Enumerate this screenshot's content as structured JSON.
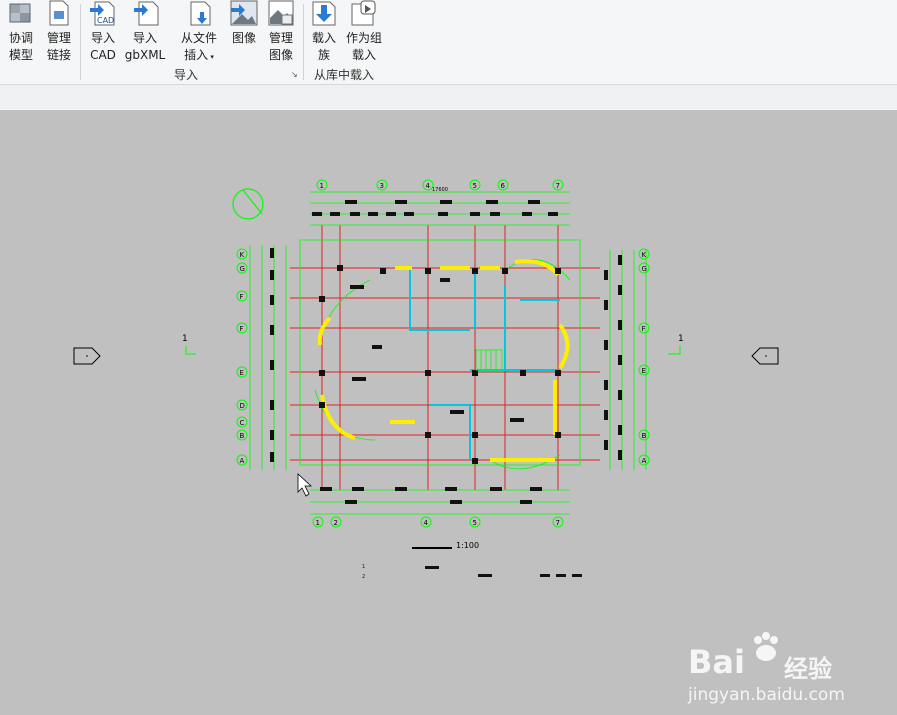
{
  "ribbon": {
    "buttons": [
      {
        "l1": "协调",
        "l2": "模型",
        "icon": "coordination-model-icon"
      },
      {
        "l1": "管理",
        "l2": "链接",
        "icon": "manage-links-icon"
      },
      {
        "l1": "导入",
        "l2": "CAD",
        "icon": "import-cad-icon",
        "badge": "CAD"
      },
      {
        "l1": "导入",
        "l2": "gbXML",
        "icon": "import-gbxml-icon"
      },
      {
        "l1": "从文件",
        "l2": "插入",
        "icon": "insert-from-file-icon"
      },
      {
        "l1": "图像",
        "l2": "",
        "icon": "image-icon"
      },
      {
        "l1": "管理",
        "l2": "图像",
        "icon": "manage-images-icon"
      },
      {
        "l1": "载入",
        "l2": "族",
        "icon": "load-family-icon"
      },
      {
        "l1": "作为组",
        "l2": "载入",
        "icon": "load-as-group-icon"
      }
    ],
    "groups": {
      "import": "导入",
      "load_from_library": "从库中载入"
    }
  },
  "drawing": {
    "scale": "1:100",
    "section_mark": "1",
    "grid_top": [
      "1",
      "3",
      "4",
      "5",
      "6",
      "7"
    ],
    "grid_bottom": [
      "1",
      "2",
      "4",
      "5",
      "7"
    ],
    "grid_left": [
      "K",
      "G",
      "F",
      "F",
      "E",
      "D",
      "C",
      "B",
      "A"
    ],
    "grid_right": [
      "K",
      "G",
      "F",
      "E",
      "B",
      "A"
    ],
    "notes": [
      "1",
      "2"
    ],
    "dim_top": "17600"
  },
  "watermark": {
    "brand": "Bai",
    "brand2": "经验",
    "url": "jingyan.baidu.com"
  }
}
